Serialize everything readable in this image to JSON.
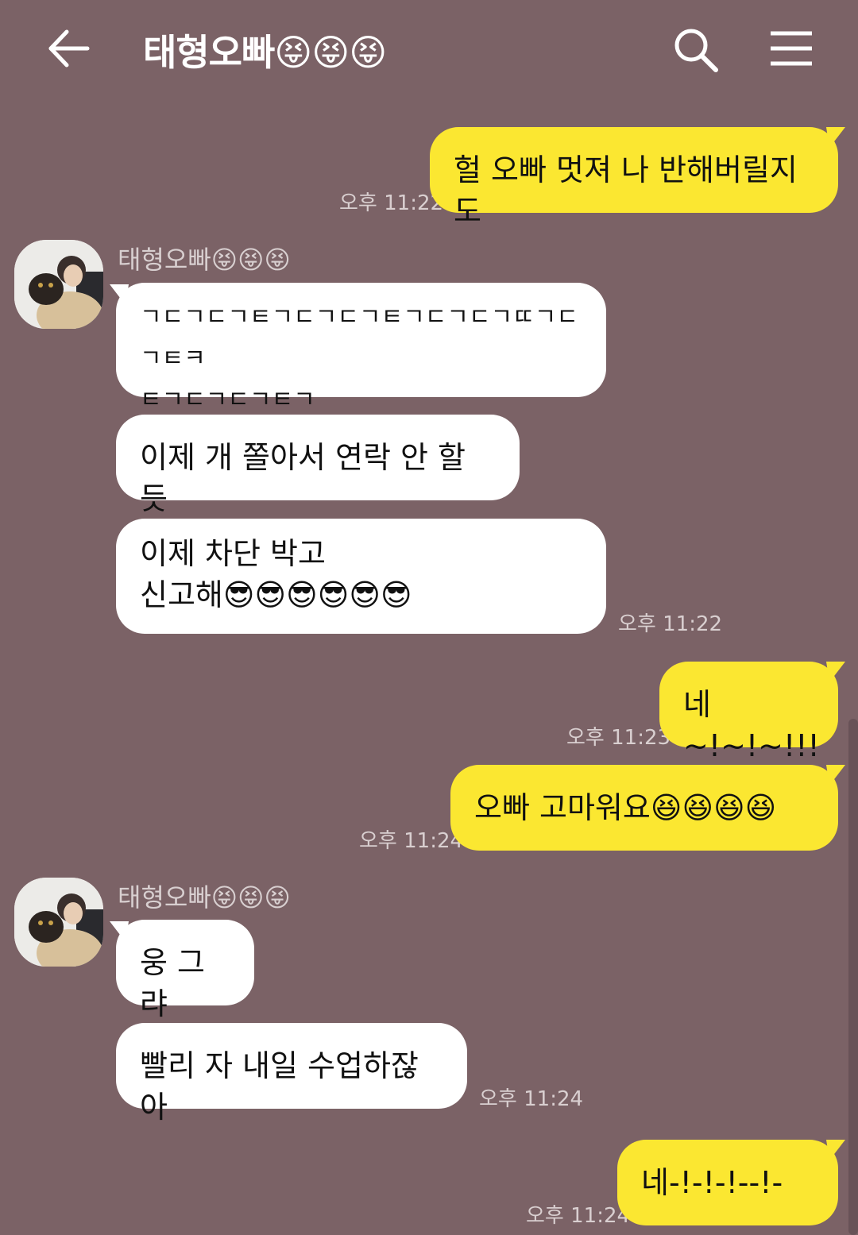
{
  "header": {
    "title": "태형오빠😝😝😝",
    "back_icon": "arrow-left-icon",
    "search_icon": "search-icon",
    "menu_icon": "hamburger-menu-icon"
  },
  "colors": {
    "background": "#7b6266",
    "my_bubble": "#fbe731",
    "their_bubble": "#ffffff"
  },
  "messages": [
    {
      "from": "me",
      "text": "헐 오빠 멋져 나 반해버릴지도",
      "time": "오후 11:22"
    },
    {
      "from": "them",
      "sender": "태형오빠😝😝😝",
      "text": "ㄱㄷㄱㄷㄱㅌㄱㄷㄱㄷㄱㅌㄱㄷㄱㄷㄱㄸㄱㄷㄱㅌㅋ\nㅌㄱㄷㄱㄷㄱㅌㄱ"
    },
    {
      "from": "them",
      "text": "이제 개 쫄아서 연락 안 할 듯"
    },
    {
      "from": "them",
      "text": "이제 차단 박고\n신고해😎😎😎😎😎😎",
      "time": "오후 11:22"
    },
    {
      "from": "me",
      "text": "네~!~!~!!!",
      "time": "오후 11:23"
    },
    {
      "from": "me",
      "text": "오빠 고마워요😆😆😆😆",
      "time": "오후 11:24"
    },
    {
      "from": "them",
      "sender": "태형오빠😝😝😝",
      "text": "웅 그랴"
    },
    {
      "from": "them",
      "text": "빨리 자 내일 수업하잖아",
      "time": "오후 11:24"
    },
    {
      "from": "me",
      "text": "네-!-!-!--!-",
      "time": "오후 11:24"
    }
  ]
}
